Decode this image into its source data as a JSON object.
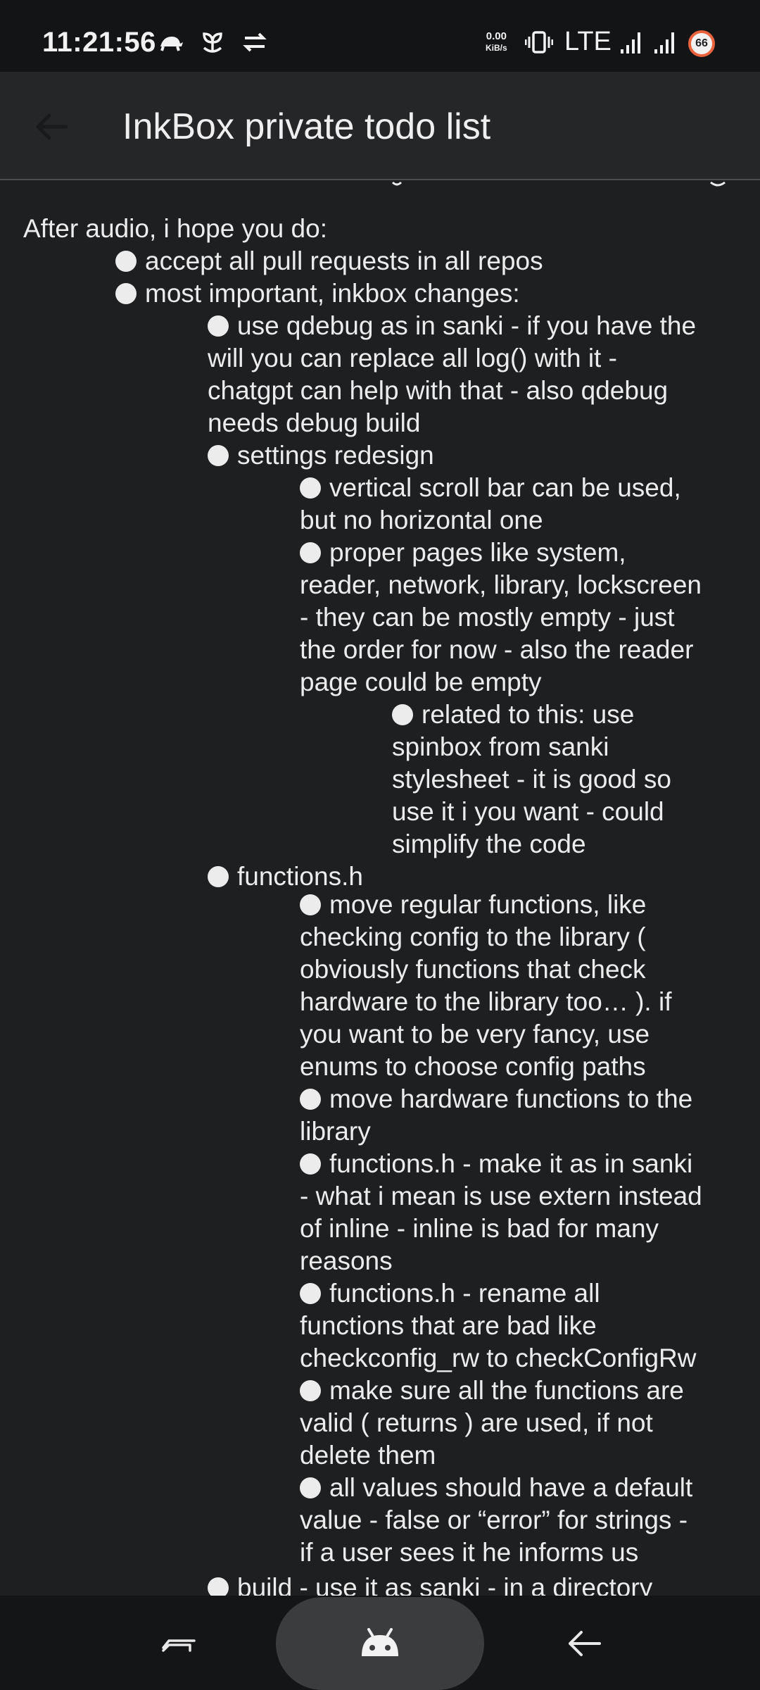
{
  "status_bar": {
    "time": "11:21:56",
    "net_speed_value": "0.00",
    "net_speed_unit": "KiB/s",
    "network": "LTE",
    "battery": "66",
    "icons": [
      "turtle-icon",
      "sprout-icon",
      "data-transfer-icon",
      "vibrate-icon",
      "signal-icon",
      "signal-icon",
      "battery-icon"
    ]
  },
  "app_bar": {
    "title": "InkBox private todo list",
    "back_icon": "arrow-left-icon"
  },
  "content": {
    "intro": "After audio, i hope you do:",
    "items": [
      {
        "lines": [
          "accept all pull requests in all repos"
        ]
      },
      {
        "lines": [
          "most important, inkbox changes:"
        ]
      },
      {
        "lines": [
          "use qdebug as in sanki - if you have the",
          "will you can replace all log() with it -",
          "chatgpt can help with that - also qdebug",
          "needs debug build"
        ]
      },
      {
        "lines": [
          "settings redesign"
        ]
      },
      {
        "lines": [
          "vertical scroll bar can be used,",
          "but no horizontal one"
        ]
      },
      {
        "lines": [
          "proper pages like system,",
          "reader, network, library, lockscreen",
          "- they can be mostly empty - just",
          "the order for now - also the reader",
          "page could be empty"
        ]
      },
      {
        "lines": [
          "related to this: use",
          "spinbox from sanki",
          "stylesheet - it is good so",
          "use it i you want - could",
          "simplify the code"
        ]
      },
      {
        "lines": [
          "functions.h"
        ]
      },
      {
        "lines": [
          "move regular functions, like",
          "checking config to the library (",
          "obviously functions that check",
          "hardware to the library too… ). if",
          "you want to be very fancy, use",
          "enums to choose config paths"
        ]
      },
      {
        "lines": [
          "move hardware functions to the",
          "library"
        ]
      },
      {
        "lines": [
          "functions.h - make it as in sanki",
          "- what i mean is use extern instead",
          "of inline - inline is bad for many",
          "reasons"
        ]
      },
      {
        "lines": [
          "functions.h - rename all",
          "functions that are bad like",
          "checkconfig_rw to checkConfigRw"
        ]
      },
      {
        "lines": [
          "make sure all the functions are",
          "valid ( returns ) are used, if not",
          "delete them"
        ]
      },
      {
        "lines": [
          "all values should have a default",
          "value - false or “error” for strings -",
          "if a user sees it he informs us"
        ]
      },
      {
        "lines": [
          "build - use it as sanki - in a directory"
        ]
      }
    ]
  },
  "nav_bar": {
    "recents_icon": "recents-icon",
    "home_icon": "android-icon",
    "back_icon": "back-icon"
  }
}
